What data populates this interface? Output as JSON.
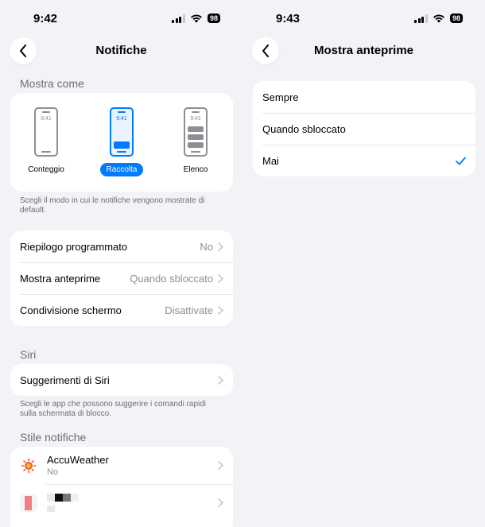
{
  "left": {
    "status": {
      "time": "9:42",
      "battery": "98"
    },
    "nav": {
      "title": "Notifiche"
    },
    "display_section": {
      "header": "Mostra come",
      "options": [
        {
          "label": "Conteggio",
          "phone_time": "9:41",
          "selected": false
        },
        {
          "label": "Raccolta",
          "phone_time": "9:41",
          "selected": true
        },
        {
          "label": "Elenco",
          "phone_time": "9:41",
          "selected": false
        }
      ],
      "footnote": "Scegli il modo in cui le notifiche vengono mostrate di default."
    },
    "settings_rows": [
      {
        "label": "Riepilogo programmato",
        "value": "No"
      },
      {
        "label": "Mostra anteprime",
        "value": "Quando sbloccato"
      },
      {
        "label": "Condivisione schermo",
        "value": "Disattivate"
      }
    ],
    "siri_section": {
      "header": "Siri",
      "row_label": "Suggerimenti di Siri",
      "footnote": "Scegli le app che possono suggerire i comandi rapidi sulla schermata di blocco."
    },
    "style_section": {
      "header": "Stile notifiche",
      "apps": [
        {
          "name": "AccuWeather",
          "status": "No",
          "icon": "accuweather-sun-icon",
          "icon_color": "#f15a24"
        },
        {
          "name": "",
          "status": "",
          "icon": "pixelated-app-icon",
          "icon_color": "#f08080"
        }
      ]
    }
  },
  "right": {
    "status": {
      "time": "9:43",
      "battery": "98"
    },
    "nav": {
      "title": "Mostra anteprime"
    },
    "options": [
      {
        "label": "Sempre",
        "checked": false
      },
      {
        "label": "Quando sbloccato",
        "checked": false
      },
      {
        "label": "Mai",
        "checked": true
      }
    ]
  },
  "colors": {
    "accent": "#007aff",
    "background": "#f2f2f7",
    "secondary_text": "#8e8e93"
  }
}
